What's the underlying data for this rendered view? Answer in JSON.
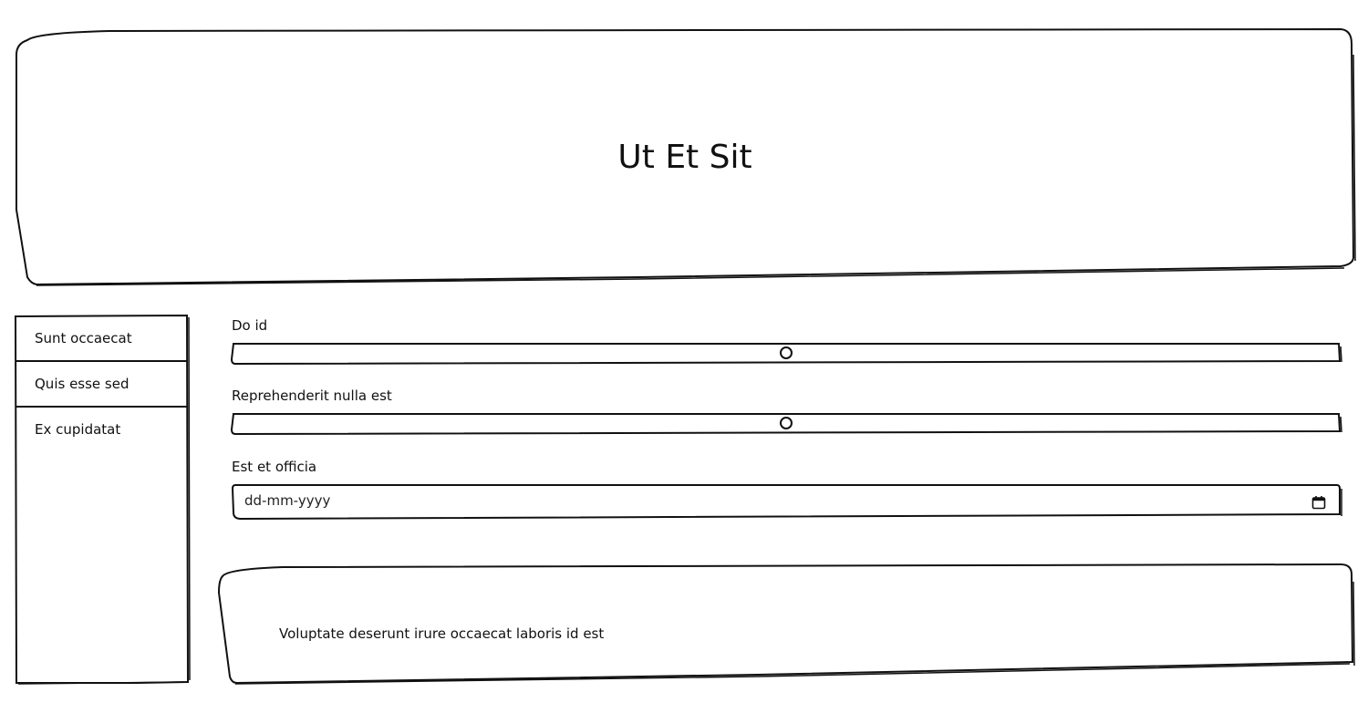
{
  "header": {
    "title": "Ut Et Sit"
  },
  "sidebar": {
    "items": [
      {
        "label": "Sunt occaecat"
      },
      {
        "label": "Quis esse sed"
      },
      {
        "label": "Ex cupidatat"
      }
    ]
  },
  "form": {
    "sliders": [
      {
        "label": "Do id",
        "value_percent": 50
      },
      {
        "label": "Reprehenderit nulla est",
        "value_percent": 50
      }
    ],
    "date": {
      "label": "Est et officia",
      "placeholder": "dd-mm-yyyy",
      "icon": "calendar-icon"
    }
  },
  "footer": {
    "text": "Voluptate deserunt irure occaecat laboris id est"
  }
}
